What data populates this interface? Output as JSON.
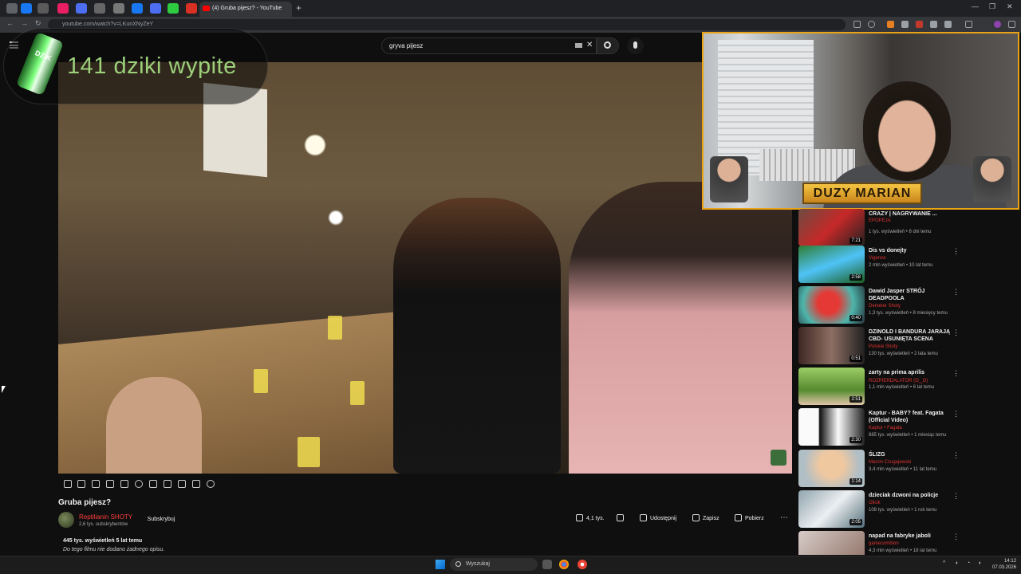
{
  "browser": {
    "active_tab_title": "(4) Gruba pijesz? - YouTube",
    "url": "youtube.com/watch?v=LKunXNyZeY",
    "new_tab": "+",
    "window_controls": [
      "—",
      "❐",
      "✕"
    ]
  },
  "youtube": {
    "logo_region": "PL",
    "search_query": "gryva pijesz"
  },
  "overlay": {
    "can_label": "DZIK",
    "counter_text": "141 dziki wypite"
  },
  "video": {
    "title": "Gruba pijesz?",
    "channel": "Reptilianin SHOTY",
    "subscribers": "2,6 tys. subskrybentów",
    "subscribe_label": "Subskrybuj",
    "likes": "4,1 tys.",
    "share_label": "Udostępnij",
    "save_label": "Zapisz",
    "download_label": "Pobierz",
    "more_label": "⋯",
    "stats": "445 tys. wyświetleń  5 lat temu",
    "description": "Do tego filmu nie dodano żadnego opisu."
  },
  "webcam": {
    "name_tag": "DUZY MARIAN"
  },
  "recommendations": [
    {
      "title": "CRAZY | NAGRYWANIE ...",
      "channel": "EPOPEJA",
      "meta": "1 tys. wyświetleń • 8 dni temu",
      "duration": "7:21"
    },
    {
      "title": "Dis vs donejty",
      "channel": "Vigenze",
      "meta": "2 mln wyświetleń • 10 lat temu",
      "duration": "2:58"
    },
    {
      "title": "Dawid Jasper STRÓJ DEADPOOLA",
      "channel": "Demeter Shoty",
      "meta": "1,3 tys. wyświetleń • 8 miesięcy temu",
      "duration": "0:40"
    },
    {
      "title": "DZINOLD I BANDURA JARAJĄ CBD- USUNIĘTA SCENA",
      "channel": "Polskie Shoty",
      "meta": "130 tys. wyświetleń • 2 lata temu",
      "duration": "0:51"
    },
    {
      "title": "zarty na prima aprilis",
      "channel": "ROZPIERDALATOR (ʘ‿ʘ)",
      "meta": "1,1 mln wyświetleń • 6 lat temu",
      "duration": "2:51"
    },
    {
      "title": "Kaptur - BABY? feat. Fagata (Official Video)",
      "channel": "Kaptur • Fagata",
      "meta": "885 tys. wyświetleń • 1 miesiąc temu",
      "duration": "2:30"
    },
    {
      "title": "ŚLIZG",
      "channel": "Marcin Czugajewski",
      "meta": "3,4 mln wyświetleń • 11 lat temu",
      "duration": "1:14"
    },
    {
      "title": "dzieciak dzwoni na policje",
      "channel": "Olicik",
      "meta": "108 tys. wyświetleń • 1 rok temu",
      "duration": "2:05"
    },
    {
      "title": "napad na fabryke jaboli",
      "channel": "gamecombion",
      "meta": "4,3 mln wyświetleń • 18 lat temu",
      "duration": ""
    }
  ],
  "taskbar": {
    "search_placeholder": "Wyszukaj",
    "time": "14:12",
    "date": "07.03.2026"
  },
  "colors": {
    "accent_red": "#ff0000",
    "webcam_border": "#e8a317",
    "counter_green": "#9cd17a"
  }
}
